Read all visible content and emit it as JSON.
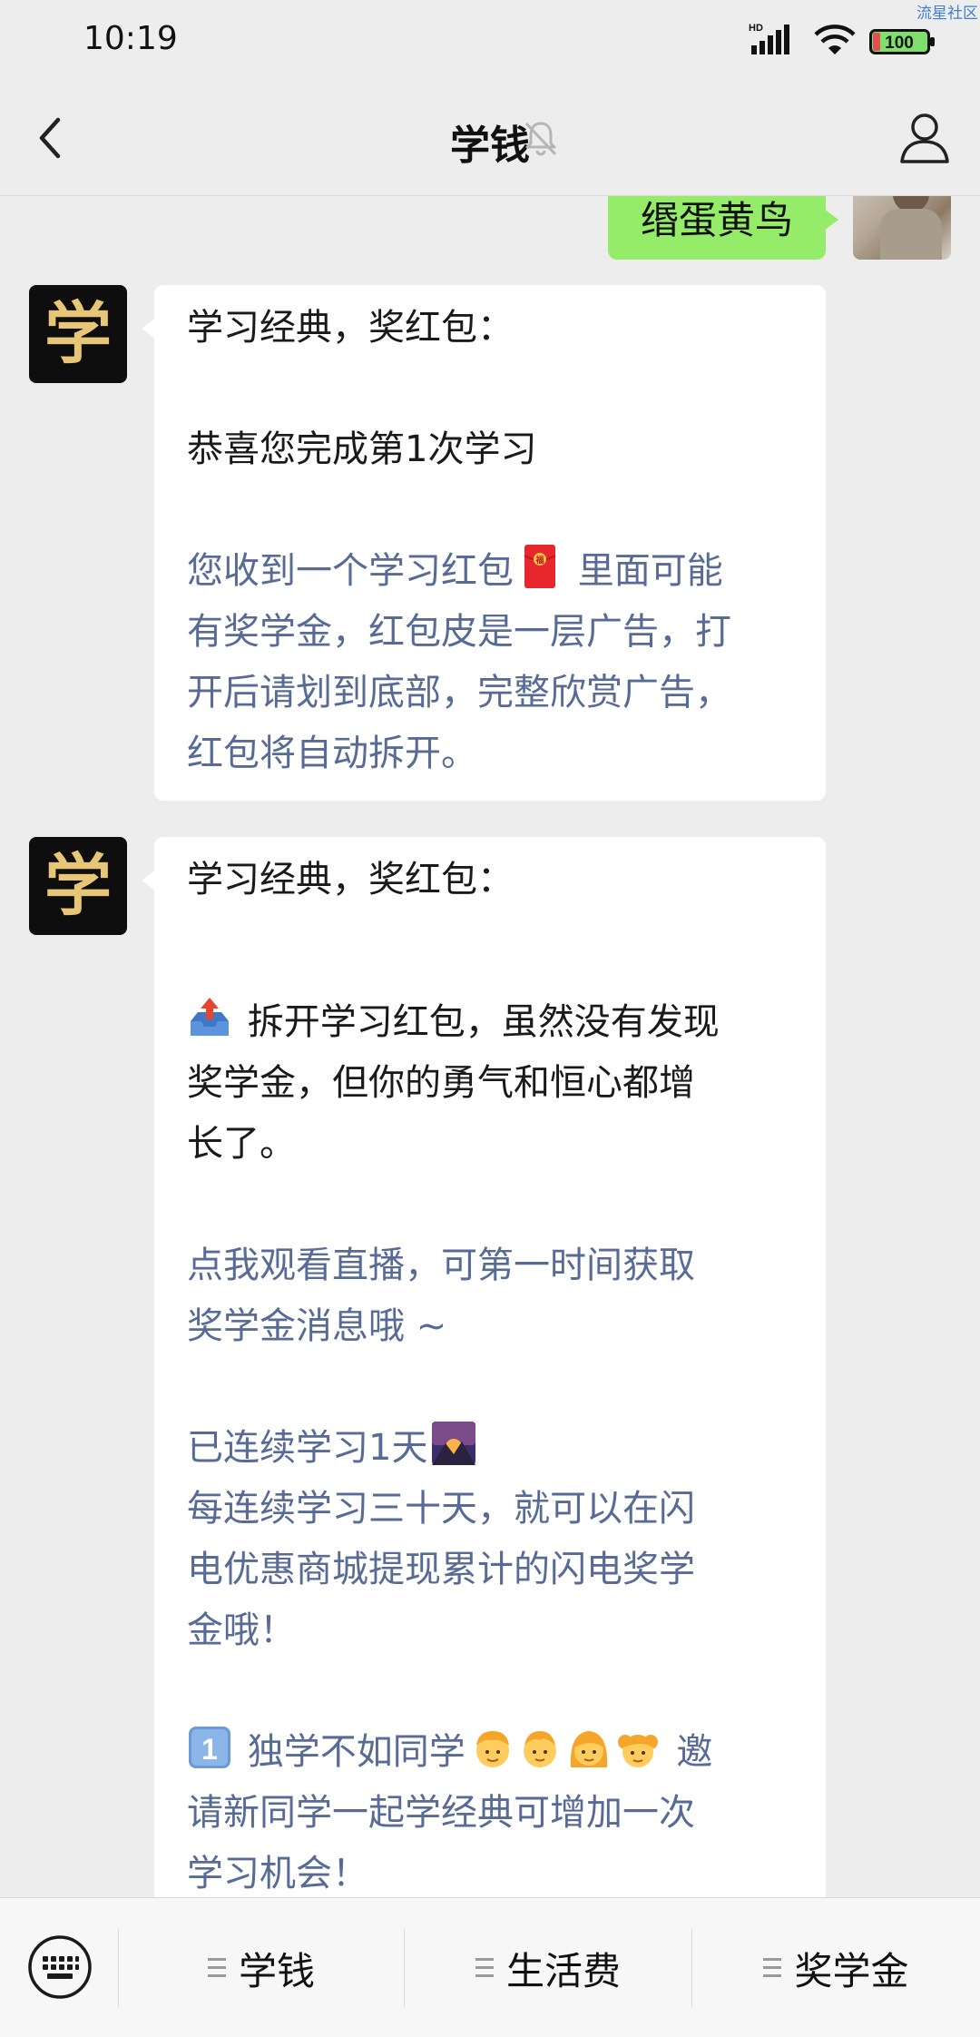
{
  "status_bar": {
    "time": "10:19",
    "network": "HD",
    "battery": "100",
    "watermark": "流星社区"
  },
  "header": {
    "title": "学钱",
    "icons": [
      "back-arrow-icon",
      "mute-bell-icon",
      "profile-icon"
    ]
  },
  "chat": {
    "sent_message": {
      "text": "缗蛋黄鸟"
    },
    "official_avatar_char": "学",
    "messages": [
      {
        "lines": [
          {
            "text": "学习经典，奖红包：",
            "color": "#1a1a1a"
          },
          {
            "text": "",
            "color": ""
          },
          {
            "text": "恭喜您完成第1次学习",
            "color": "#1a1a1a"
          },
          {
            "text": "",
            "color": ""
          },
          {
            "text": "您收到一个学习红包",
            "suffix": " 里面可能",
            "emoji": "red-envelope",
            "color": "#576b95"
          },
          {
            "text": "有奖学金，红包皮是一层广告，打",
            "color": "#576b95"
          },
          {
            "text": "开后请划到底部，完整欣赏广告，",
            "color": "#576b95"
          },
          {
            "text": "红包将自动拆开。",
            "color": "#576b95"
          }
        ]
      },
      {
        "lines": [
          {
            "text": "学习经典，奖红包：",
            "color": "#1a1a1a"
          },
          {
            "text": "",
            "color": ""
          },
          {
            "prefix_emoji": "outbox-tray",
            "text": " 拆开学习红包，虽然没有发现",
            "color": "#1a1a1a"
          },
          {
            "text": "奖学金，但你的勇气和恒心都增",
            "color": "#1a1a1a"
          },
          {
            "text": "长了。",
            "color": "#1a1a1a"
          },
          {
            "text": "",
            "color": ""
          },
          {
            "text": "点我观看直播，可第一时间获取",
            "color": "#576b95"
          },
          {
            "text": "奖学金消息哦 ~",
            "color": "#576b95"
          },
          {
            "text": "",
            "color": ""
          },
          {
            "text": "已连续学习1天",
            "emoji": "sunrise-mountains",
            "color": "#576b95"
          },
          {
            "text": "每连续学习三十天，就可以在闪",
            "color": "#576b95"
          },
          {
            "text": "电优惠商城提现累计的闪电奖学",
            "color": "#576b95"
          },
          {
            "text": "金哦！",
            "color": "#576b95"
          },
          {
            "text": "",
            "color": ""
          },
          {
            "prefix_emoji": "keycap-1",
            "text": " 独学不如同学",
            "emoji_group": "four-people",
            "suffix": " 邀",
            "color": "#576b95"
          },
          {
            "text": "请新同学一起学经典可增加一次",
            "color": "#576b95"
          },
          {
            "text": "学习机会！",
            "color": "#576b95"
          }
        ]
      }
    ]
  },
  "bottom_menu": {
    "keyboard_icon": "keyboard-icon",
    "items": [
      {
        "label": "学钱"
      },
      {
        "label": "生活费"
      },
      {
        "label": "奖学金"
      }
    ]
  },
  "colors": {
    "background": "#ededed",
    "sent_bubble": "#95ec69",
    "received_bubble": "#ffffff",
    "link_text": "#576b95",
    "avatar_gold": "#e8c678"
  }
}
